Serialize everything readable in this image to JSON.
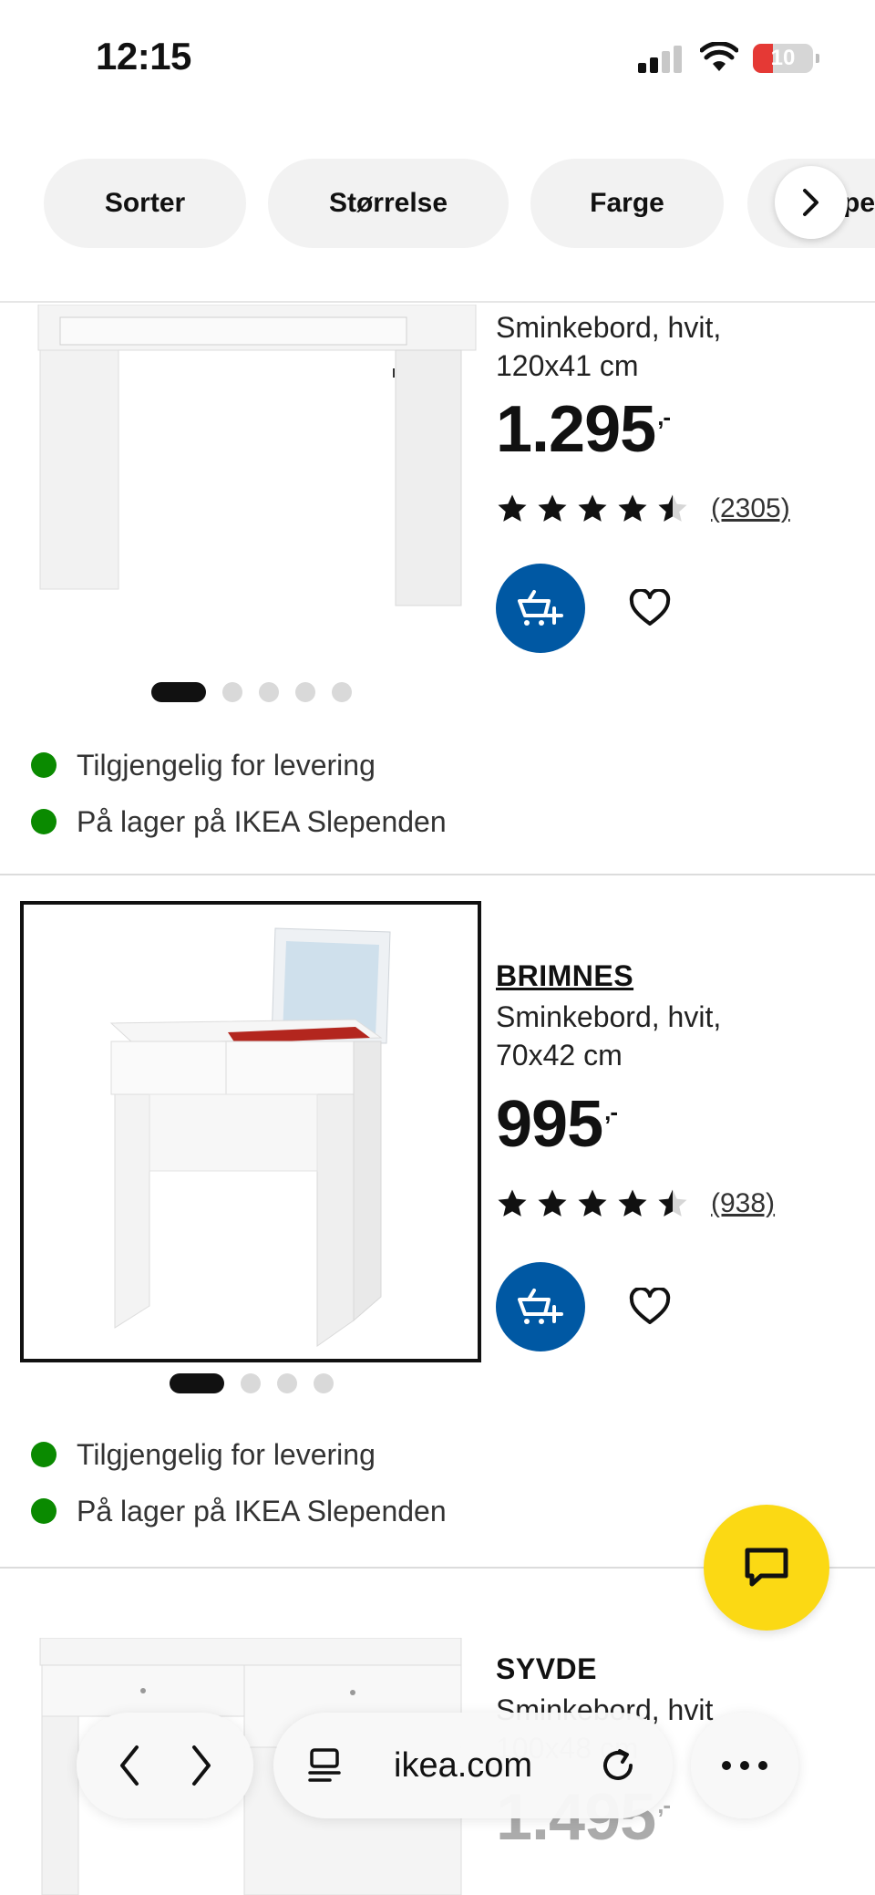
{
  "status_bar": {
    "time": "12:15",
    "battery": "10"
  },
  "filters": [
    {
      "label": "Sorter"
    },
    {
      "label": "Størrelse"
    },
    {
      "label": "Farge"
    }
  ],
  "filters_next_partial": "pe",
  "products": [
    {
      "name": "",
      "description_line1": "Sminkebord, hvit,",
      "description_line2": "120x41 cm",
      "price": "1.295",
      "price_suffix": ",-",
      "rating": 4.5,
      "reviews": "(2305)",
      "availability": [
        "Tilgjengelig for levering",
        "På lager på IKEA Slependen"
      ],
      "images_count": 5
    },
    {
      "name": "BRIMNES",
      "description_line1": "Sminkebord, hvit,",
      "description_line2": "70x42 cm",
      "price": "995",
      "price_suffix": ",-",
      "rating": 4.5,
      "reviews": "(938)",
      "availability": [
        "Tilgjengelig for levering",
        "På lager på IKEA Slependen"
      ],
      "images_count": 4
    },
    {
      "name": "SYVDE",
      "description_line1": "Sminkebord, hvit",
      "description_line2": "100x48 cm",
      "price": "1.495",
      "price_suffix": ",-"
    }
  ],
  "browser": {
    "url": "ikea.com"
  },
  "colors": {
    "ikea_blue": "#0058a3",
    "chat_yellow": "#fbd914",
    "stock_green": "#0a8a00",
    "battery_red": "#e53935"
  }
}
